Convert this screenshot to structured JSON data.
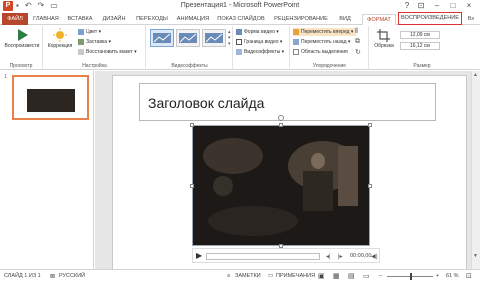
{
  "window": {
    "title": "Презентация1 - Microsoft PowerPoint",
    "app_icon": "P",
    "help": "?",
    "minimize": "–",
    "maximize": "□",
    "close": "×",
    "account": "Вх",
    "restore_ribbon": "⊡"
  },
  "quick_access": {
    "save_icon": "save-icon",
    "undo_icon": "undo-icon",
    "redo_icon": "redo-icon",
    "start_icon": "start-slideshow-icon"
  },
  "tabs": [
    {
      "label": "ФАЙЛ"
    },
    {
      "label": "ГЛАВНАЯ"
    },
    {
      "label": "ВСТАВКА"
    },
    {
      "label": "ДИЗАЙН"
    },
    {
      "label": "ПЕРЕХОДЫ"
    },
    {
      "label": "АНИМАЦИЯ"
    },
    {
      "label": "ПОКАЗ СЛАЙДОВ"
    },
    {
      "label": "РЕЦЕНЗИРОВАНИЕ"
    },
    {
      "label": "ВИД"
    },
    {
      "label": "ФОРМАТ"
    },
    {
      "label": "ВОСПРОИЗВЕДЕНИЕ"
    }
  ],
  "ribbon": {
    "preview": {
      "button": "Воспроизвести",
      "group": "Просмотр"
    },
    "adjust": {
      "correction": "Коррекция",
      "color": "Цвет",
      "poster_frame": "Заставка",
      "reset_design": "Восстановить макет",
      "group": "Настройка"
    },
    "video_styles": {
      "group": "Видеоэффекты"
    },
    "video_options": {
      "video_shape": "Форма видео",
      "video_border": "Граница видео",
      "video_effects": "Видеоэффекты"
    },
    "arrange": {
      "bring_forward": "Переместить вперед",
      "send_backward": "Переместить назад",
      "selection_pane": "Область выделения",
      "group": "Упорядочение"
    },
    "size": {
      "crop": "Обрезка",
      "height": "12,09 см",
      "width": "16,12 см",
      "group": "Размер"
    }
  },
  "slides_pane": {
    "slide_number": "1"
  },
  "slide": {
    "title": "Заголовок слайда"
  },
  "player": {
    "time": "00:00,00",
    "progress_fraction": 0
  },
  "statusbar": {
    "slide_info": "СЛАЙД 1 ИЗ 1",
    "language": "РУССКИЙ",
    "notes": "ЗАМЕТКИ",
    "comments": "ПРИМЕЧАНИЯ",
    "zoom": "61 %",
    "zoom_minus": "–",
    "zoom_plus": "+"
  },
  "colors": {
    "accent": "#b7472a",
    "highlight_box": "#dd3333",
    "thumb_border": "#e8824a"
  }
}
